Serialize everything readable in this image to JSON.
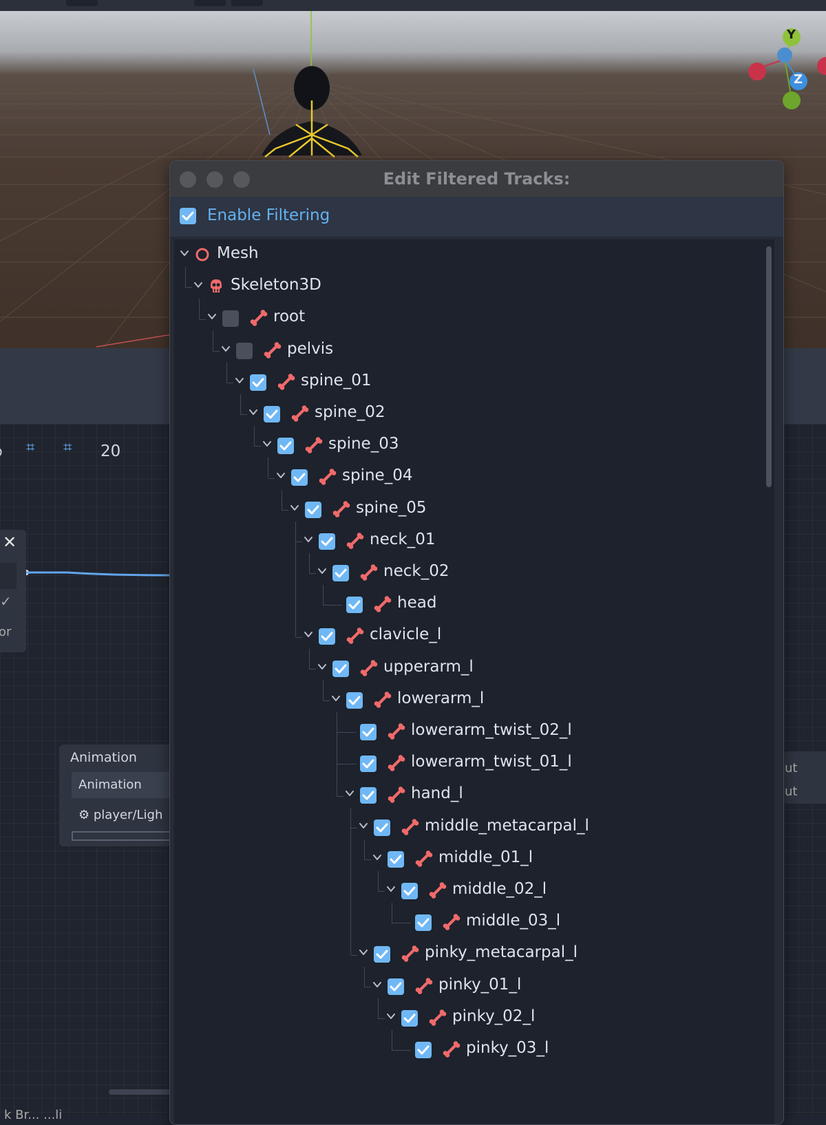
{
  "dialog": {
    "title": "Edit Filtered Tracks:",
    "enable_filtering_label": "Enable Filtering",
    "enable_filtering_checked": true
  },
  "tree": [
    {
      "label": "Mesh",
      "icon": "mesh-icon",
      "checkbox": null,
      "expand": true
    },
    {
      "label": "Skeleton3D",
      "icon": "skeleton-icon",
      "checkbox": null,
      "expand": true
    },
    {
      "label": "root",
      "icon": "bone-icon",
      "checkbox": false,
      "expand": true
    },
    {
      "label": "pelvis",
      "icon": "bone-icon",
      "checkbox": false,
      "expand": true
    },
    {
      "label": "spine_01",
      "icon": "bone-icon",
      "checkbox": true,
      "expand": true
    },
    {
      "label": "spine_02",
      "icon": "bone-icon",
      "checkbox": true,
      "expand": true
    },
    {
      "label": "spine_03",
      "icon": "bone-icon",
      "checkbox": true,
      "expand": true
    },
    {
      "label": "spine_04",
      "icon": "bone-icon",
      "checkbox": true,
      "expand": true
    },
    {
      "label": "spine_05",
      "icon": "bone-icon",
      "checkbox": true,
      "expand": true
    },
    {
      "label": "neck_01",
      "icon": "bone-icon",
      "checkbox": true,
      "expand": true
    },
    {
      "label": "neck_02",
      "icon": "bone-icon",
      "checkbox": true,
      "expand": true
    },
    {
      "label": "head",
      "icon": "bone-icon",
      "checkbox": true,
      "expand": false
    },
    {
      "label": "clavicle_l",
      "icon": "bone-icon",
      "checkbox": true,
      "expand": true
    },
    {
      "label": "upperarm_l",
      "icon": "bone-icon",
      "checkbox": true,
      "expand": true
    },
    {
      "label": "lowerarm_l",
      "icon": "bone-icon",
      "checkbox": true,
      "expand": true
    },
    {
      "label": "lowerarm_twist_02_l",
      "icon": "bone-icon",
      "checkbox": true,
      "expand": false
    },
    {
      "label": "lowerarm_twist_01_l",
      "icon": "bone-icon",
      "checkbox": true,
      "expand": false
    },
    {
      "label": "hand_l",
      "icon": "bone-icon",
      "checkbox": true,
      "expand": true
    },
    {
      "label": "middle_metacarpal_l",
      "icon": "bone-icon",
      "checkbox": true,
      "expand": true
    },
    {
      "label": "middle_01_l",
      "icon": "bone-icon",
      "checkbox": true,
      "expand": true
    },
    {
      "label": "middle_02_l",
      "icon": "bone-icon",
      "checkbox": true,
      "expand": true
    },
    {
      "label": "middle_03_l",
      "icon": "bone-icon",
      "checkbox": true,
      "expand": false
    },
    {
      "label": "pinky_metacarpal_l",
      "icon": "bone-icon",
      "checkbox": true,
      "expand": true
    },
    {
      "label": "pinky_01_l",
      "icon": "bone-icon",
      "checkbox": true,
      "expand": true
    },
    {
      "label": "pinky_02_l",
      "icon": "bone-icon",
      "checkbox": true,
      "expand": true
    },
    {
      "label": "pinky_03_l",
      "icon": "bone-icon",
      "checkbox": true,
      "expand": false
    }
  ],
  "background": {
    "gizmo": {
      "y": "Y",
      "z": "Z"
    },
    "snap_value": "20",
    "node_animation": {
      "title": "Animation",
      "field": "Animation",
      "player": "player/Ligh"
    },
    "left_node_text": "or",
    "right_node": [
      "ut",
      "ut"
    ],
    "bottom_text": "k Br... ...li"
  },
  "colors": {
    "accent": "#70b8f5",
    "bone_icon": "#f06a6a",
    "dialog_bg": "#1d222c"
  }
}
